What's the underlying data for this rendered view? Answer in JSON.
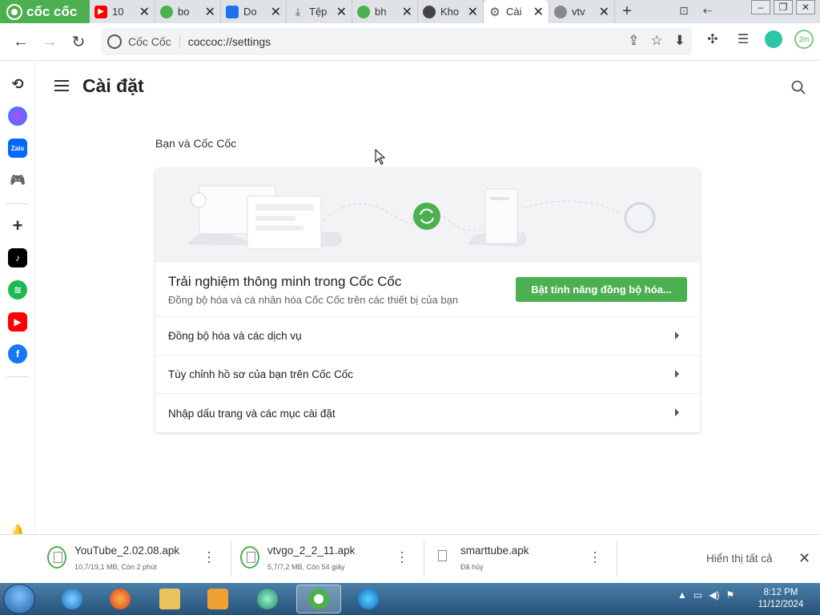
{
  "browser": {
    "brand": "cốc cốc",
    "tabs": [
      {
        "label": "10",
        "icon": "youtube-icon",
        "color": "#ff0000"
      },
      {
        "label": "bo",
        "icon": "coccoc-green-icon",
        "color": "#4caf50"
      },
      {
        "label": "Do",
        "icon": "drive-icon",
        "color": "#1a73e8"
      },
      {
        "label": "Tệp",
        "icon": "download-icon",
        "color": "#555555"
      },
      {
        "label": "bh",
        "icon": "coccoc-green-icon",
        "color": "#4caf50"
      },
      {
        "label": "Kho",
        "icon": "globe-icon",
        "color": "#444444"
      },
      {
        "label": "Cài",
        "icon": "gear-icon",
        "color": "#555555",
        "active": true
      },
      {
        "label": "vtv",
        "icon": "globe-icon",
        "color": "#888888"
      }
    ],
    "site_name": "Cốc Cốc",
    "url": "coccoc://settings"
  },
  "page": {
    "title": "Cài đặt",
    "section_label": "Bạn và Cốc Cốc",
    "sync": {
      "title": "Trải nghiệm thông minh trong Cốc Cốc",
      "subtitle": "Đồng bộ hóa và cá nhân hóa Cốc Cốc trên các thiết bị của bạn",
      "button": "Bật tính năng đồng bộ hóa..."
    },
    "rows": [
      "Đồng bộ hóa và các dịch vụ",
      "Tùy chỉnh hồ sơ của bạn trên Cốc Cốc",
      "Nhập dấu trang và các mục cài đặt"
    ]
  },
  "downloads": {
    "items": [
      {
        "name": "YouTube_2.02.08.apk",
        "status": "10,7/19,1 MB, Còn 2 phút"
      },
      {
        "name": "vtvgo_2_2_11.apk",
        "status": "5,7/7,2 MB, Còn 54 giây"
      },
      {
        "name": "smarttube.apk",
        "status": "Đã hủy"
      }
    ],
    "show_all": "Hiển thị tất cả"
  },
  "taskbar": {
    "time": "8:12 PM",
    "date": "11/12/2024"
  },
  "colors": {
    "accent": "#4caf50",
    "taskbar": "#27527a"
  }
}
